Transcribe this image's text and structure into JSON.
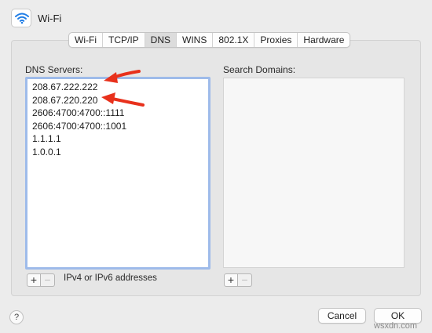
{
  "window": {
    "title": "Wi-Fi",
    "icon": "wifi-icon"
  },
  "tabs": [
    {
      "label": "Wi-Fi",
      "active": false
    },
    {
      "label": "TCP/IP",
      "active": false
    },
    {
      "label": "DNS",
      "active": true
    },
    {
      "label": "WINS",
      "active": false
    },
    {
      "label": "802.1X",
      "active": false
    },
    {
      "label": "Proxies",
      "active": false
    },
    {
      "label": "Hardware",
      "active": false
    }
  ],
  "dns": {
    "label": "DNS Servers:",
    "servers": [
      "208.67.222.222",
      "208.67.220.220",
      "2606:4700:4700::1111",
      "2606:4700:4700::1001",
      "1.1.1.1",
      "1.0.0.1"
    ],
    "add_symbol": "+",
    "remove_symbol": "−",
    "hint": "IPv4 or IPv6 addresses"
  },
  "search_domains": {
    "label": "Search Domains:",
    "items": [],
    "add_symbol": "+",
    "remove_symbol": "−"
  },
  "footer": {
    "help": "?",
    "cancel": "Cancel",
    "ok": "OK"
  },
  "watermark": "wsxdn.com",
  "colors": {
    "focus_ring": "#9ebbea",
    "annotation_arrow": "#e8311c"
  }
}
